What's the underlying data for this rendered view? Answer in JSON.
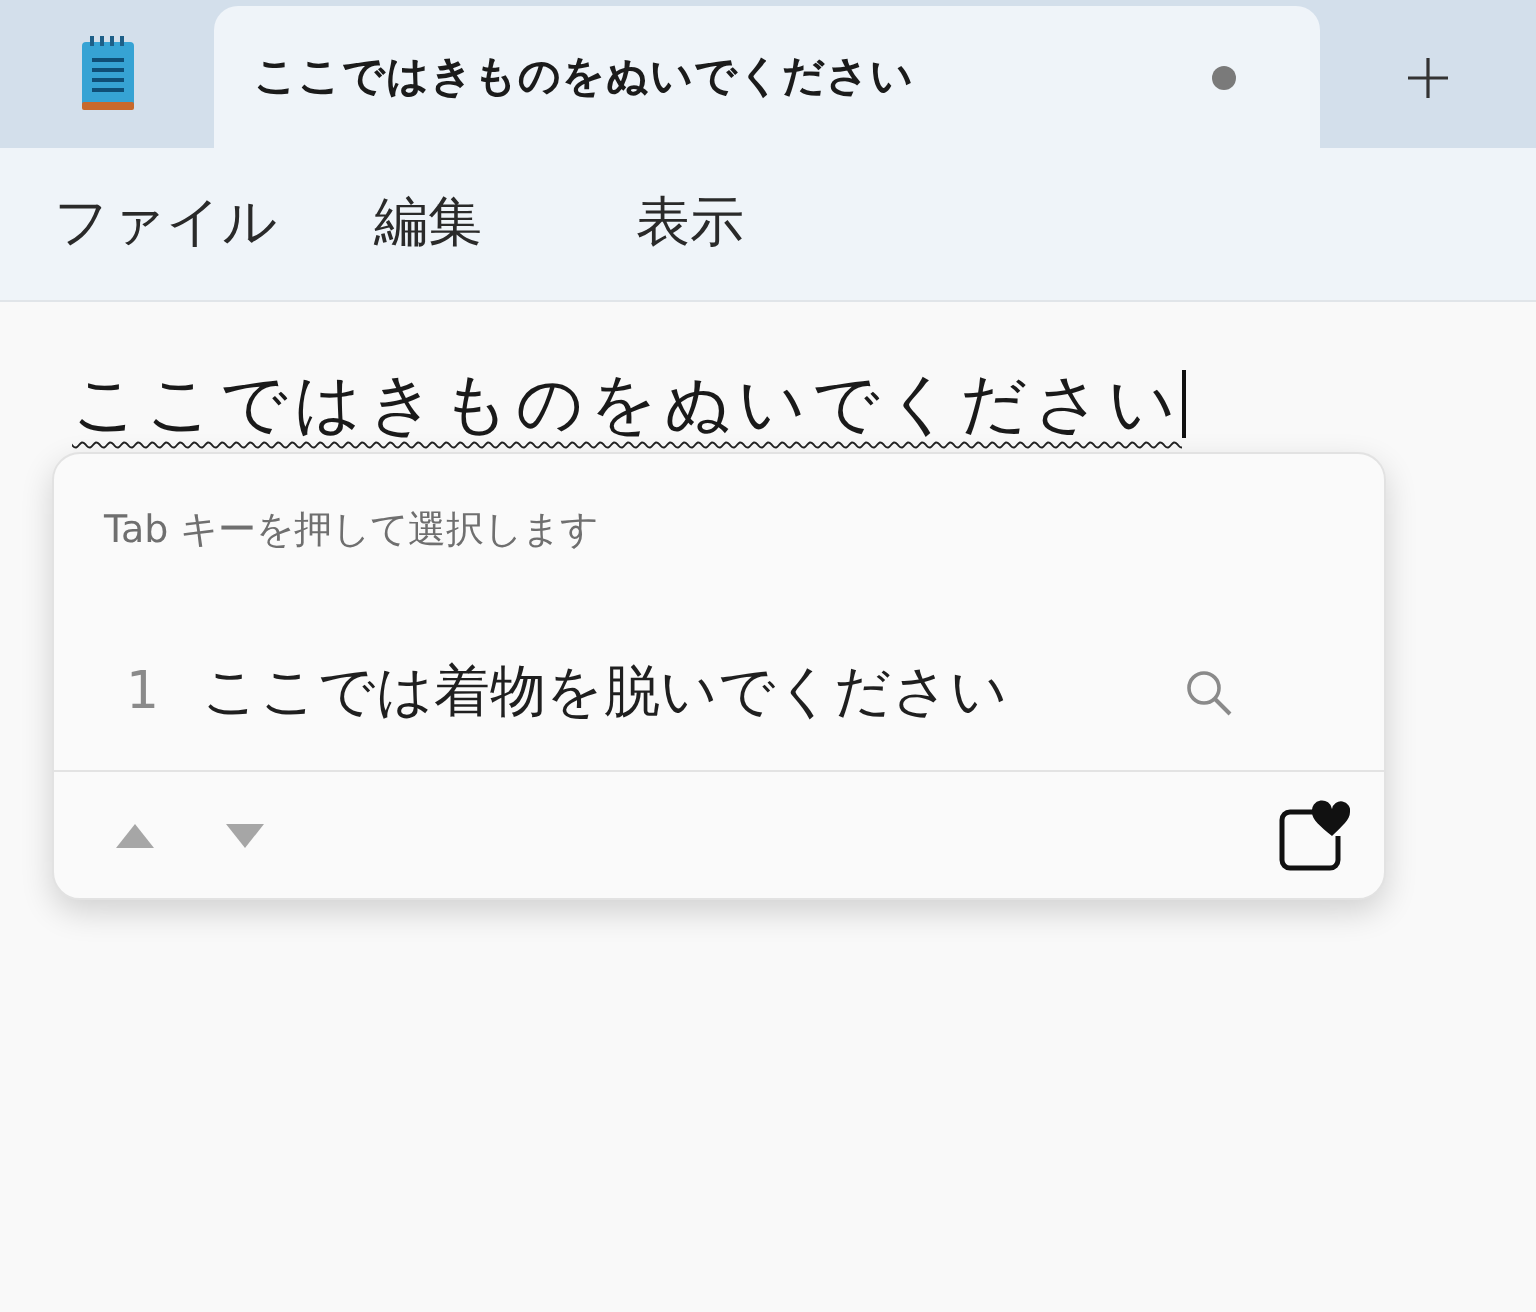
{
  "tabs": [
    {
      "title": "ここではきものをぬいでください",
      "unsaved": true,
      "selected": true
    }
  ],
  "menu": [
    {
      "label": "ファイル"
    },
    {
      "label": "編集"
    },
    {
      "label": "表示"
    }
  ],
  "editor": {
    "text": "ここではきものをぬいでください",
    "composing": true
  },
  "ime_popup": {
    "hint": "Tab キーを押して選択します",
    "candidates": [
      {
        "number": "1",
        "text": "ここでは着物を脱いでください",
        "selected": false
      }
    ]
  }
}
